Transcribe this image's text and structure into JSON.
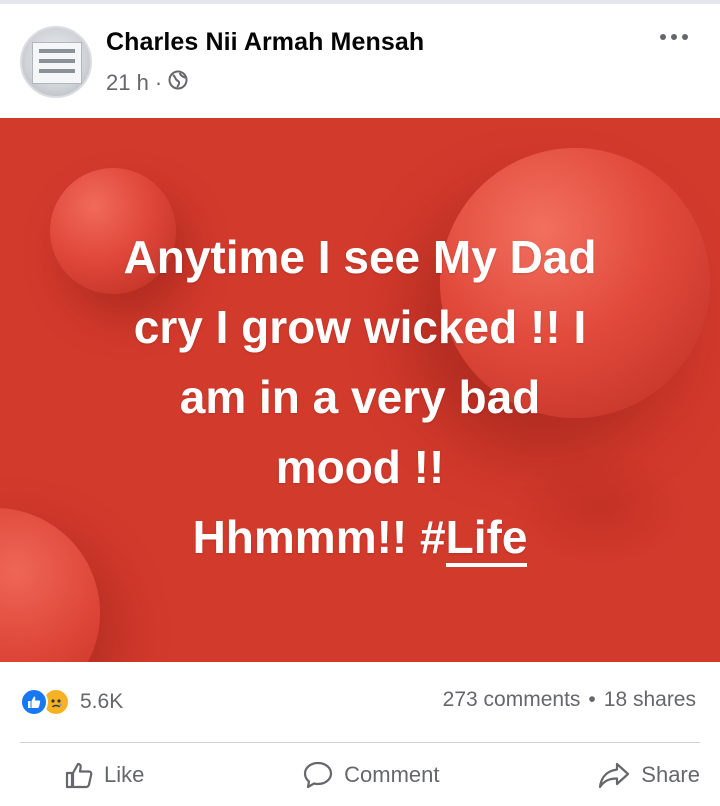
{
  "post": {
    "author_name": "Charles Nii Armah Mensah",
    "timestamp": "21 h",
    "separator": "·",
    "privacy_icon": "globe-icon",
    "more_icon": "more-options-icon",
    "background_color": "#d23a2c",
    "text_lines": [
      "Anytime I see My Dad",
      "cry I grow wicked !! I",
      "am in a very bad",
      "mood !!"
    ],
    "last_line_text": "Hhmmm!! ",
    "hashtag": "#",
    "hashtag_link": "Life"
  },
  "stats": {
    "reaction_icons": [
      "like-reaction-icon",
      "sad-reaction-icon"
    ],
    "reaction_count": "5.6K",
    "comments": "273 comments",
    "dot": "•",
    "shares": "18 shares"
  },
  "actions": {
    "like_label": "Like",
    "comment_label": "Comment",
    "share_label": "Share"
  },
  "colors": {
    "like_blue": "#1877f2",
    "sad_yellow": "#f7b125",
    "meta_gray": "#65676b"
  }
}
